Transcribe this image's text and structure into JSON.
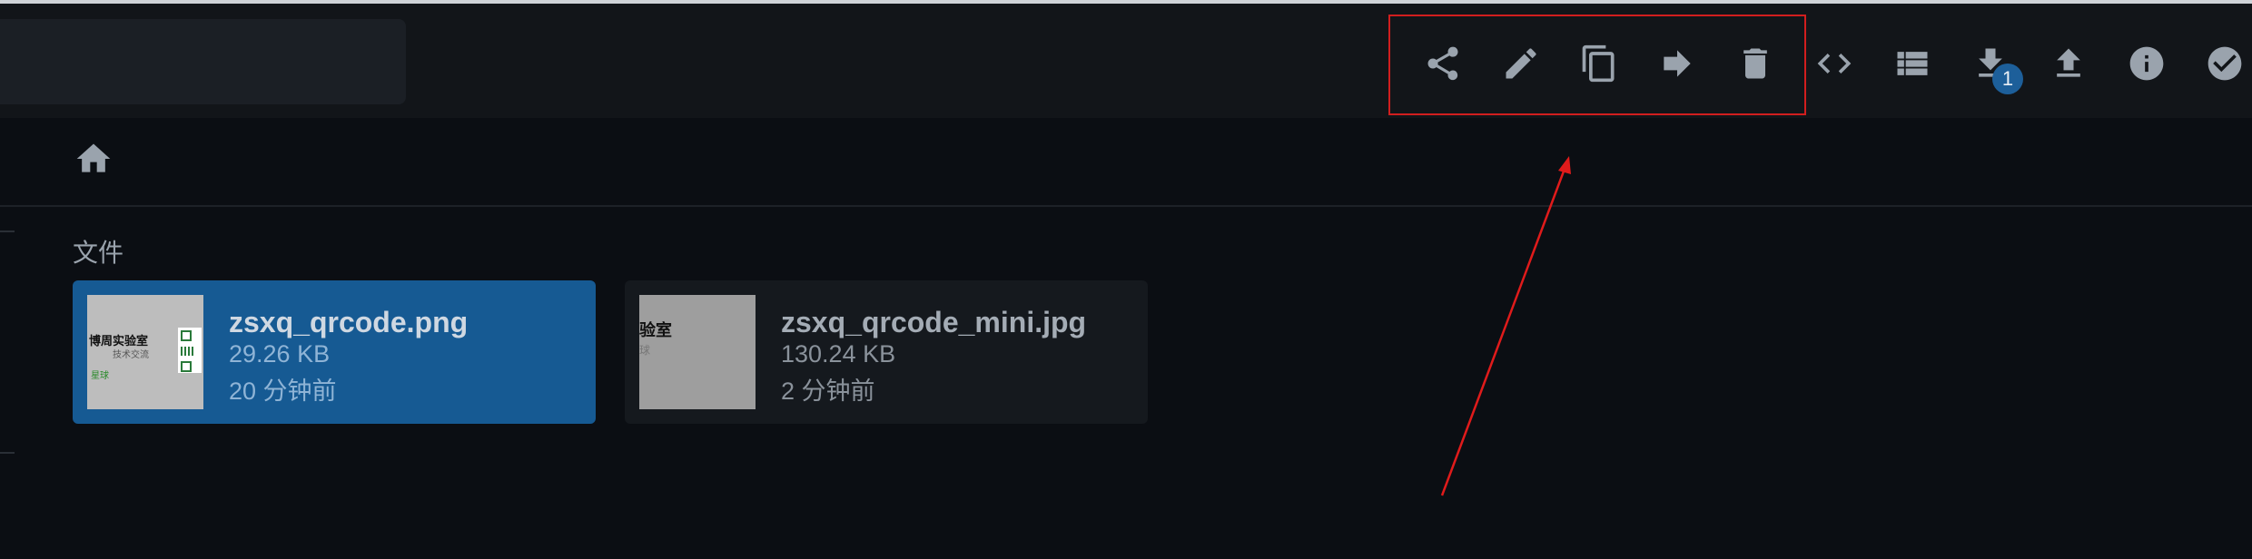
{
  "toolbar": {
    "icons": [
      "share-icon",
      "edit-icon",
      "copy-icon",
      "move-icon",
      "delete-icon",
      "code-icon",
      "list-view-icon",
      "download-icon",
      "upload-icon",
      "info-icon",
      "select-icon"
    ],
    "download_badge": "1"
  },
  "breadcrumb": {
    "home_icon": "home-icon"
  },
  "files_section": {
    "title": "文件",
    "items": [
      {
        "name": "zsxq_qrcode.png",
        "size": "29.26 KB",
        "modified": "20 分钟前",
        "selected": true,
        "thumb_text_1": "博周实验室",
        "thumb_text_2": "技术交流",
        "thumb_text_3": "星球"
      },
      {
        "name": "zsxq_qrcode_mini.jpg",
        "size": "130.24 KB",
        "modified": "2 分钟前",
        "selected": false,
        "thumb_text_1": "验室",
        "thumb_text_2": "球"
      }
    ]
  },
  "colors": {
    "accent": "#165a93",
    "annotation": "#d11e1e",
    "badge": "#1d5f9a"
  }
}
